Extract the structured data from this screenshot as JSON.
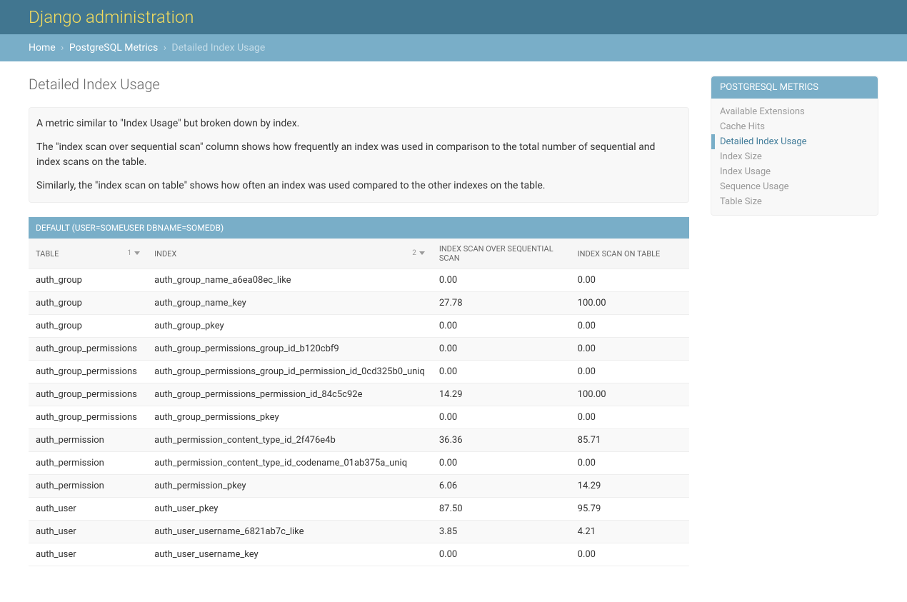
{
  "header": {
    "title": "Django administration"
  },
  "breadcrumbs": {
    "home": "Home",
    "section": "PostgreSQL Metrics",
    "current": "Detailed Index Usage"
  },
  "page": {
    "title": "Detailed Index Usage"
  },
  "help": {
    "p1": "A metric similar to \"Index Usage\" but broken down by index.",
    "p2": "The \"index scan over sequential scan\" column shows how frequently an index was used in comparison to the total number of sequential and index scans on the table.",
    "p3": "Similarly, the \"index scan on table\" shows how often an index was used compared to the other indexes on the table."
  },
  "table": {
    "caption": "DEFAULT (USER=SOMEUSER DBNAME=SOMEDB)",
    "headers": {
      "table": "TABLE",
      "index": "INDEX",
      "scan_seq": "INDEX SCAN OVER SEQUENTIAL SCAN",
      "scan_table": "INDEX SCAN ON TABLE"
    },
    "sort": {
      "col1_priority": "1",
      "col2_priority": "2"
    },
    "rows": [
      {
        "table": "auth_group",
        "index": "auth_group_name_a6ea08ec_like",
        "scan_seq": "0.00",
        "scan_table": "0.00"
      },
      {
        "table": "auth_group",
        "index": "auth_group_name_key",
        "scan_seq": "27.78",
        "scan_table": "100.00"
      },
      {
        "table": "auth_group",
        "index": "auth_group_pkey",
        "scan_seq": "0.00",
        "scan_table": "0.00"
      },
      {
        "table": "auth_group_permissions",
        "index": "auth_group_permissions_group_id_b120cbf9",
        "scan_seq": "0.00",
        "scan_table": "0.00"
      },
      {
        "table": "auth_group_permissions",
        "index": "auth_group_permissions_group_id_permission_id_0cd325b0_uniq",
        "scan_seq": "0.00",
        "scan_table": "0.00"
      },
      {
        "table": "auth_group_permissions",
        "index": "auth_group_permissions_permission_id_84c5c92e",
        "scan_seq": "14.29",
        "scan_table": "100.00"
      },
      {
        "table": "auth_group_permissions",
        "index": "auth_group_permissions_pkey",
        "scan_seq": "0.00",
        "scan_table": "0.00"
      },
      {
        "table": "auth_permission",
        "index": "auth_permission_content_type_id_2f476e4b",
        "scan_seq": "36.36",
        "scan_table": "85.71"
      },
      {
        "table": "auth_permission",
        "index": "auth_permission_content_type_id_codename_01ab375a_uniq",
        "scan_seq": "0.00",
        "scan_table": "0.00"
      },
      {
        "table": "auth_permission",
        "index": "auth_permission_pkey",
        "scan_seq": "6.06",
        "scan_table": "14.29"
      },
      {
        "table": "auth_user",
        "index": "auth_user_pkey",
        "scan_seq": "87.50",
        "scan_table": "95.79"
      },
      {
        "table": "auth_user",
        "index": "auth_user_username_6821ab7c_like",
        "scan_seq": "3.85",
        "scan_table": "4.21"
      },
      {
        "table": "auth_user",
        "index": "auth_user_username_key",
        "scan_seq": "0.00",
        "scan_table": "0.00"
      }
    ]
  },
  "sidebar": {
    "title": "POSTGRESQL METRICS",
    "items": [
      {
        "label": "Available Extensions",
        "selected": false
      },
      {
        "label": "Cache Hits",
        "selected": false
      },
      {
        "label": "Detailed Index Usage",
        "selected": true
      },
      {
        "label": "Index Size",
        "selected": false
      },
      {
        "label": "Index Usage",
        "selected": false
      },
      {
        "label": "Sequence Usage",
        "selected": false
      },
      {
        "label": "Table Size",
        "selected": false
      }
    ]
  }
}
